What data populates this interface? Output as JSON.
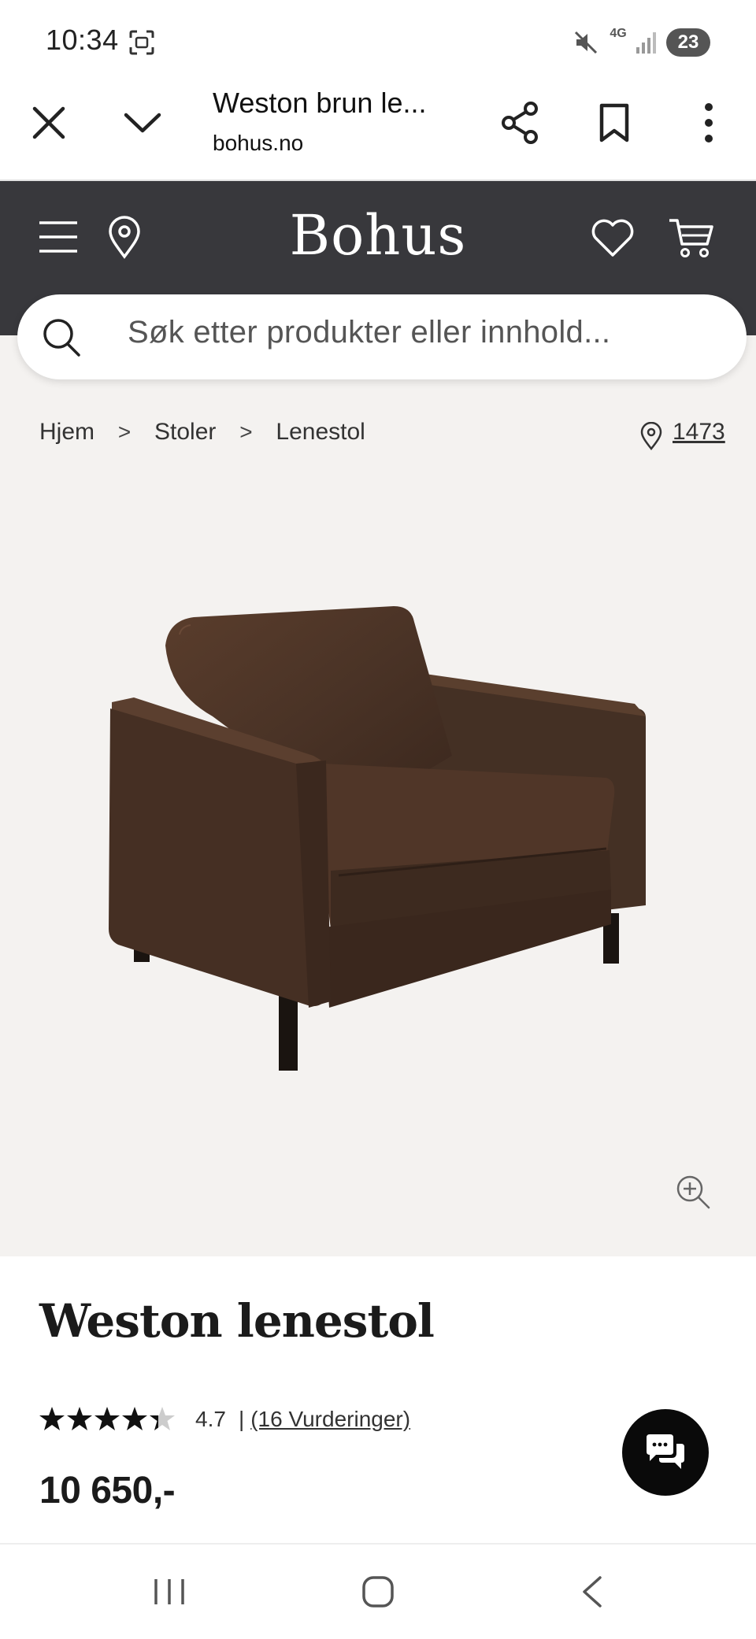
{
  "status_bar": {
    "time": "10:34",
    "network": "4G",
    "battery": "23"
  },
  "browser": {
    "tab_title": "Weston brun le...",
    "url": "bohus.no"
  },
  "site": {
    "logo": "Bohus",
    "search_placeholder": "Søk etter produkter eller innhold..."
  },
  "breadcrumb": {
    "items": [
      "Hjem",
      "Stoler",
      "Lenestol"
    ],
    "separator": ">",
    "store_number": "1473"
  },
  "product": {
    "title": "Weston lenestol",
    "rating": 4.7,
    "rating_text": "4.7",
    "rating_separator": "|",
    "reviews_text": "(16 Vurderinger)",
    "price": "10 650,-"
  },
  "colors": {
    "header_bg": "#38383c",
    "content_bg": "#f4f2f0",
    "chair_leather": "#4a3326",
    "chat_button": "#0a0a0a"
  },
  "icons": {
    "close": "close-icon",
    "chevron": "chevron-down-icon",
    "share": "share-icon",
    "bookmark": "bookmark-icon",
    "more": "more-icon",
    "menu": "menu-icon",
    "location": "location-icon",
    "wishlist": "heart-icon",
    "cart": "cart-icon",
    "search": "search-icon",
    "zoom": "zoom-in-icon",
    "chat": "chat-icon"
  }
}
